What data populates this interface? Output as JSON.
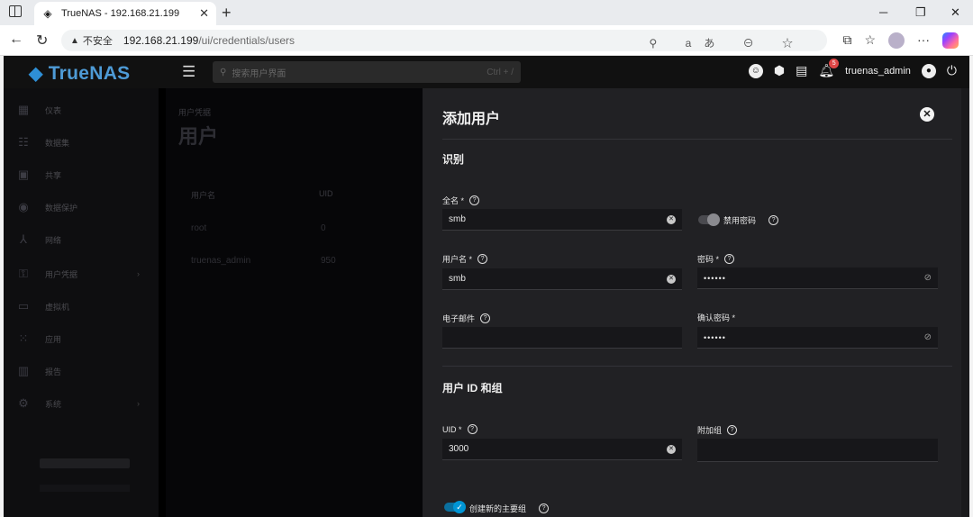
{
  "browser": {
    "tab_title": "TrueNAS - 192.168.21.199",
    "tab_close": "✕",
    "new_tab": "+",
    "insecure_label": "不安全",
    "url_host": "192.168.21.199",
    "url_path": "/ui/credentials/users",
    "win_minimize": "─",
    "win_restore": "❐",
    "win_close": "✕"
  },
  "topbar": {
    "logo": "TrueNAS",
    "search_placeholder": "搜索用户界面",
    "search_shortcut": "Ctrl + /",
    "notification_count": "5",
    "username": "truenas_admin"
  },
  "sidebar": {
    "items": [
      {
        "label": "仪表",
        "icon": "dashboard-icon"
      },
      {
        "label": "数据集",
        "icon": "datasets-icon"
      },
      {
        "label": "共享",
        "icon": "shares-icon"
      },
      {
        "label": "数据保护",
        "icon": "data-protection-icon"
      },
      {
        "label": "网络",
        "icon": "network-icon"
      },
      {
        "label": "用户凭据",
        "icon": "key-icon",
        "has_arrow": true
      },
      {
        "label": "虚拟机",
        "icon": "laptop-icon"
      },
      {
        "label": "应用",
        "icon": "apps-icon"
      },
      {
        "label": "报告",
        "icon": "reports-icon"
      },
      {
        "label": "系统",
        "icon": "gear-icon",
        "has_arrow": true
      }
    ]
  },
  "content": {
    "breadcrumb": "用户凭据",
    "title": "用户",
    "columns": [
      "用户名",
      "UID"
    ],
    "rows": [
      {
        "username": "root",
        "uid": "0"
      },
      {
        "username": "truenas_admin",
        "uid": "950"
      }
    ]
  },
  "panel": {
    "title": "添加用户",
    "section_identity": "识别",
    "full_name_label": "全名 *",
    "full_name_value": "smb",
    "disable_password_label": "禁用密码",
    "username_label": "用户名 *",
    "username_value": "smb",
    "password_label": "密码 *",
    "password_value": "••••••",
    "email_label": "电子邮件",
    "email_value": "",
    "confirm_password_label": "确认密码 *",
    "confirm_password_value": "••••••",
    "section_ids": "用户 ID 和组",
    "uid_label": "UID *",
    "uid_value": "3000",
    "aux_groups_label": "附加组",
    "aux_groups_value": "",
    "create_group_label": "创建新的主要组",
    "create_group_checked": true,
    "disable_password_checked": false
  },
  "colors": {
    "accent": "#0095d5",
    "logo": "#4e9bd6",
    "panel_bg": "#212124",
    "page_bg": "#000000"
  }
}
